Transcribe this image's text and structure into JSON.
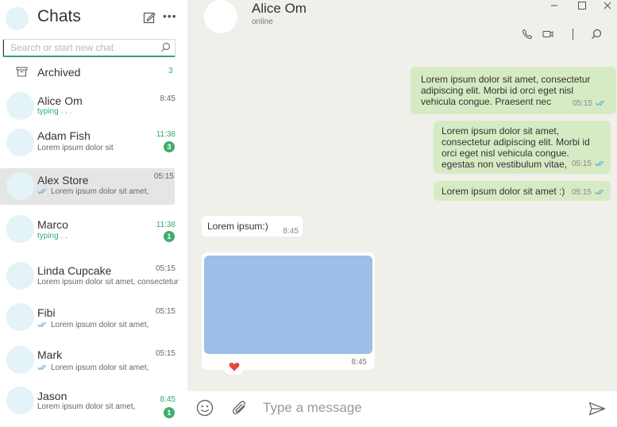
{
  "sidebar": {
    "title": "Chats",
    "search_placeholder": "Search or start new chat",
    "archived": {
      "label": "Archived",
      "count": "3"
    },
    "chats": [
      {
        "name": "Alice Om",
        "preview": "typing . . .",
        "time": "8:45"
      },
      {
        "name": "Adam Fish",
        "preview": "Lorem ipsum dolor sit",
        "time": "11:38",
        "badge": "3"
      },
      {
        "name": "Alex Store",
        "preview": "Lorem ipsum dolor sit amet,",
        "time": "05:15"
      },
      {
        "name": "Marco",
        "preview": "typing . .",
        "time": "11:38",
        "badge": "1"
      },
      {
        "name": "Linda Cupcake",
        "preview": "Lorem ipsum dolor sit amet, consectetur",
        "time": "05:15"
      },
      {
        "name": "Fibi",
        "preview": "Lorem ipsum dolor sit amet,",
        "time": "05:15"
      },
      {
        "name": "Mark",
        "preview": "Lorem ipsum dolor sit amet,",
        "time": "05:15"
      },
      {
        "name": "Jason",
        "preview": "Lorem ipsum dolor sit amet,",
        "time": "8:45",
        "badge": "1"
      }
    ]
  },
  "conversation": {
    "peer_name": "Alice Om",
    "peer_status": "online",
    "messages": [
      {
        "text": "Lorem ipsum dolor sit amet, consectetur adipiscing elit. Morbi id orci eget nisl vehicula congue. Praesent nec",
        "time": "05:15"
      },
      {
        "text": "Lorem ipsum dolor sit amet, consectetur adipiscing elit. Morbi id orci eget nisl vehicula congue. egestas non vestibulum vitae,",
        "time": "05:15"
      },
      {
        "text": "Lorem ipsum dolor sit amet :)",
        "time": "05:15"
      },
      {
        "text": "Lorem ipsum:)",
        "time": "8:45"
      }
    ],
    "image_time": "8:45"
  },
  "composer": {
    "placeholder": "Type a message"
  },
  "colors": {
    "accent": "#2eaa74",
    "badge": "#3fae6b",
    "outgoing_bubble": "#d6ebc4",
    "chat_background": "#f0efea",
    "image_placeholder": "#9bbfe6",
    "reaction_heart": "#e8453c"
  },
  "icons": {
    "compose": "edit-icon",
    "more": "more-icon",
    "search": "search-icon",
    "archive": "archive-icon",
    "call": "phone-icon",
    "video": "video-icon",
    "emoji": "emoji-icon",
    "attach": "paperclip-icon",
    "send": "send-icon",
    "reaction": "heart-icon"
  }
}
